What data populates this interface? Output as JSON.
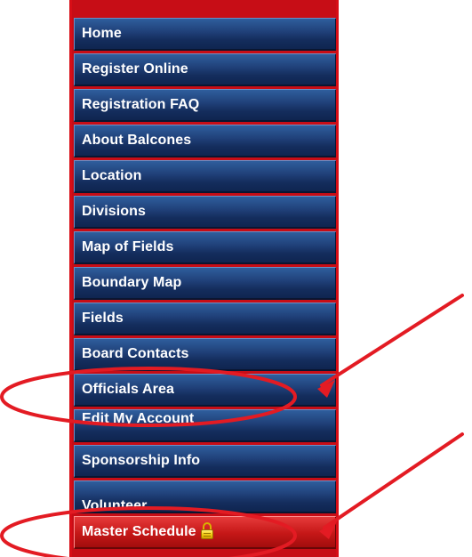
{
  "menu": {
    "items": [
      {
        "label": "Home"
      },
      {
        "label": "Register Online"
      },
      {
        "label": "Registration FAQ"
      },
      {
        "label": "About Balcones"
      },
      {
        "label": "Location"
      },
      {
        "label": "Divisions"
      },
      {
        "label": "Map of Fields"
      },
      {
        "label": "Boundary Map"
      },
      {
        "label": "Fields"
      },
      {
        "label": "Board Contacts"
      },
      {
        "label": "Officials Area"
      },
      {
        "label": "Edit My Account"
      },
      {
        "label": "Sponsorship Info"
      },
      {
        "label": "Volunteer"
      },
      {
        "label": "Master Schedule"
      }
    ]
  },
  "colors": {
    "menu_frame": "#c70d16",
    "menu_item": "#1f3f77",
    "active_item": "#c51717",
    "annotation": "#e31b23",
    "lock": "#f5cf19"
  },
  "icons": {
    "lock": "lock-icon",
    "arrow": "arrow-icon"
  }
}
